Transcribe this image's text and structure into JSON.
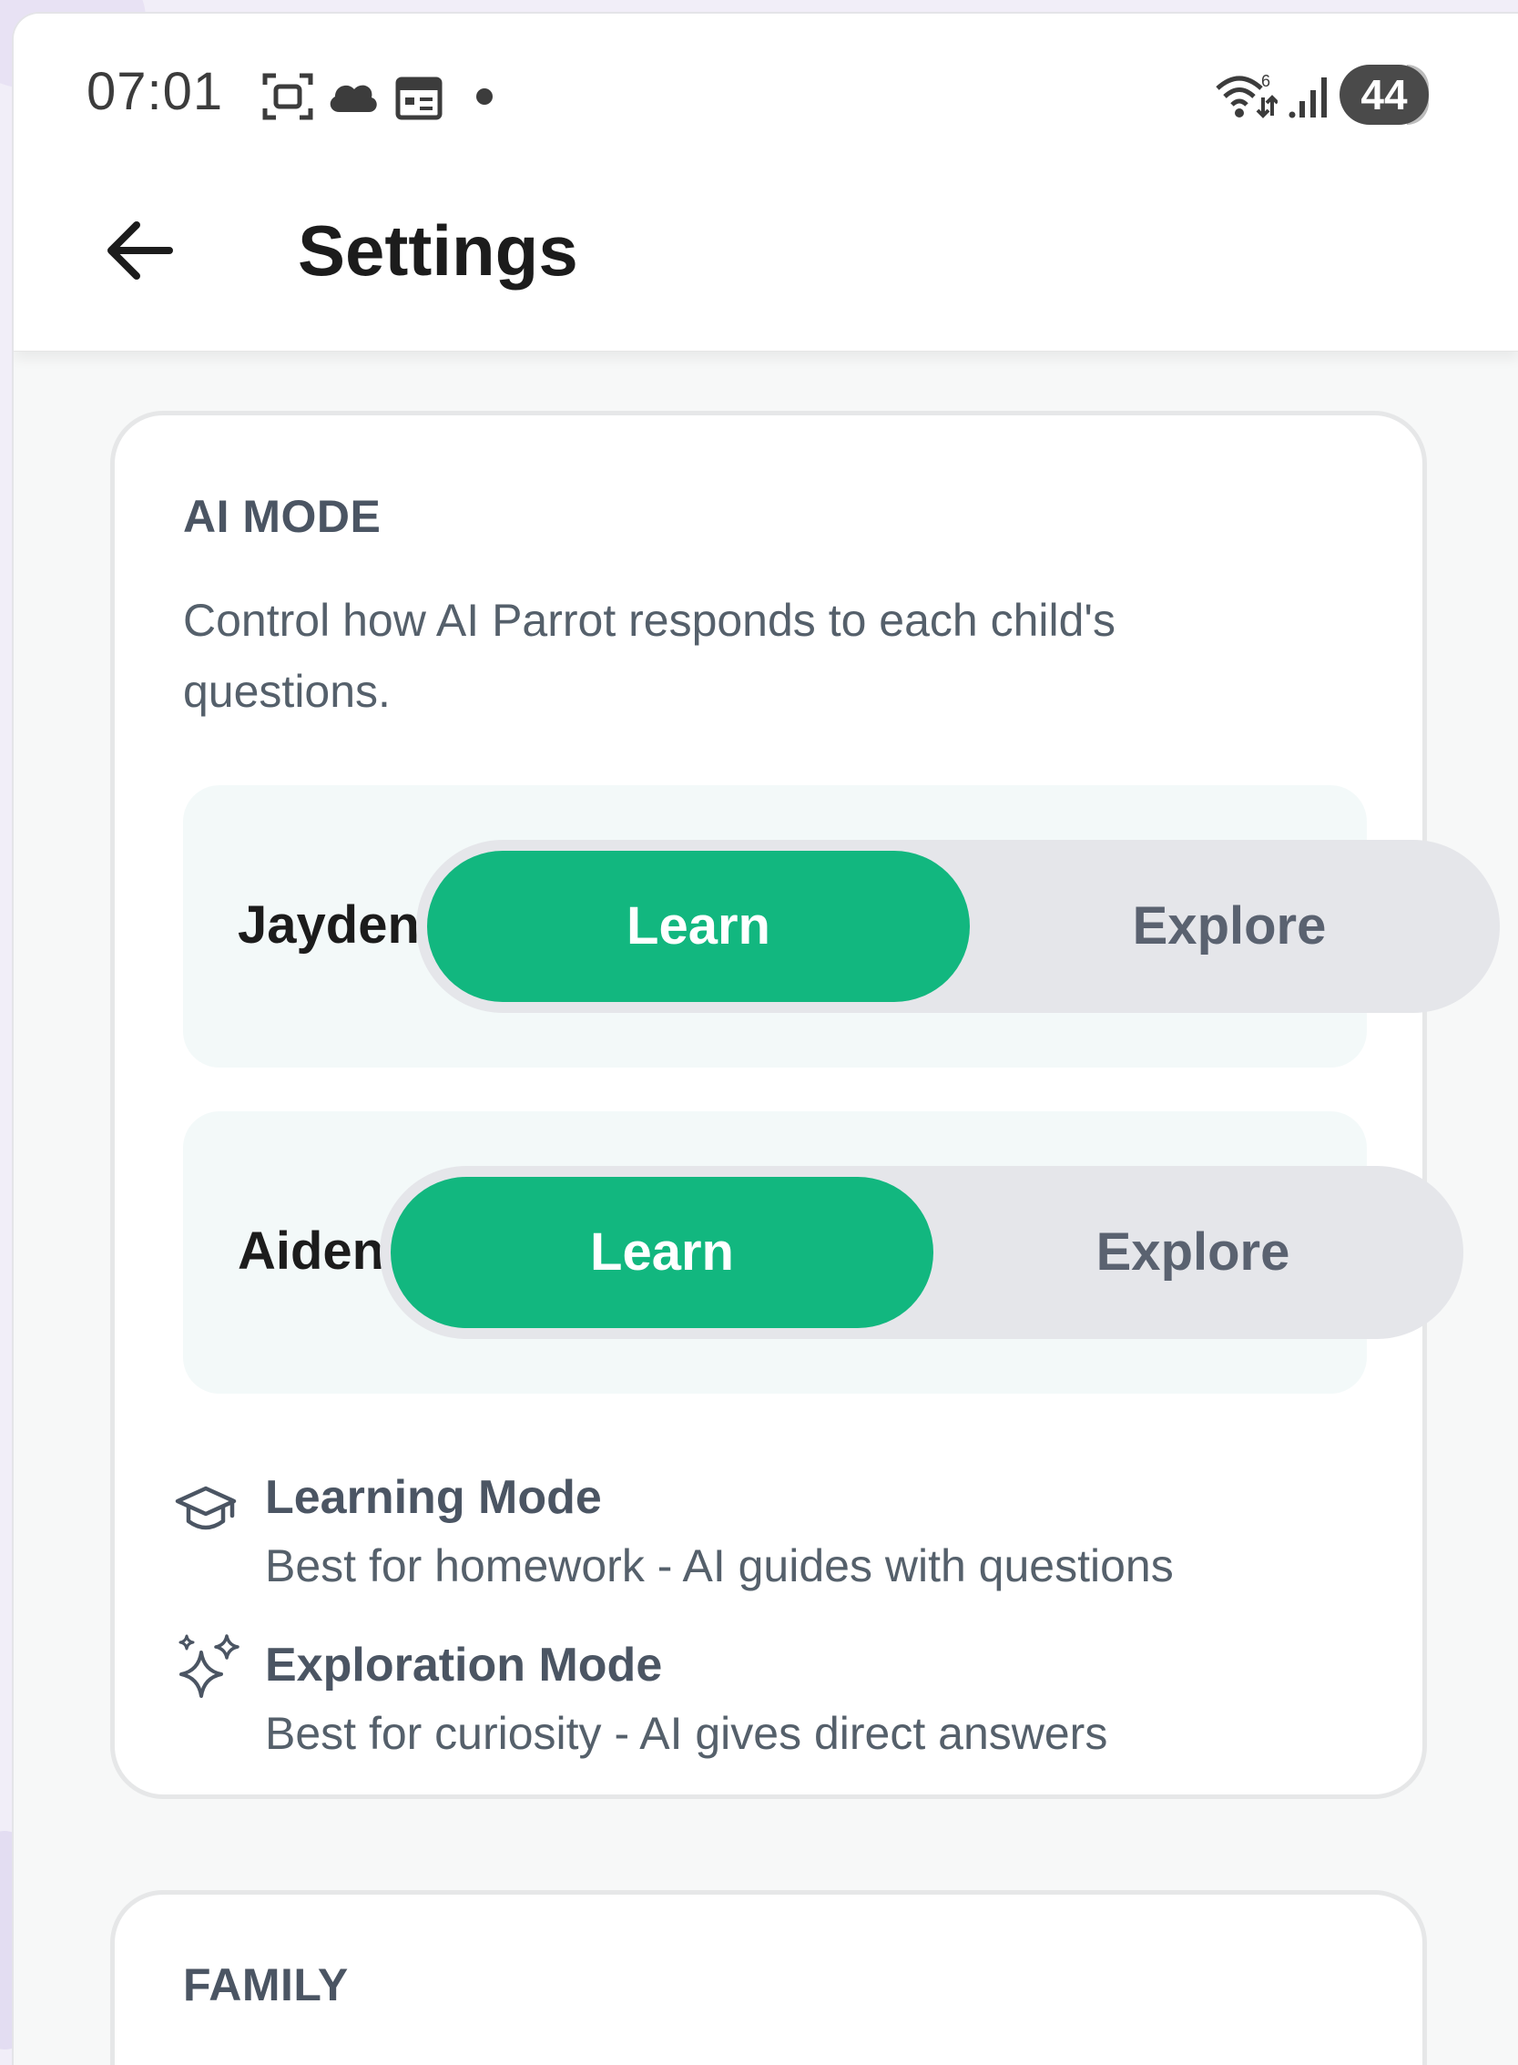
{
  "status_bar": {
    "time": "07:01",
    "battery_level": "44",
    "icons": [
      "screenshot-icon",
      "cloud-icon",
      "calendar-icon",
      "notification-dot-icon",
      "wifi-6-icon",
      "signal-icon",
      "battery-icon"
    ]
  },
  "header": {
    "title": "Settings",
    "back_icon": "arrow-left-icon"
  },
  "ai_mode": {
    "heading": "AI MODE",
    "description": "Control how AI Parrot responds to each child's questions.",
    "children": [
      {
        "name": "Jayden",
        "learn_label": "Learn",
        "explore_label": "Explore",
        "selected": "Learn"
      },
      {
        "name": "Aiden",
        "learn_label": "Learn",
        "explore_label": "Explore",
        "selected": "Learn"
      }
    ],
    "modes": [
      {
        "icon": "graduation-cap-icon",
        "title": "Learning Mode",
        "description": "Best for homework - AI guides with questions"
      },
      {
        "icon": "sparkles-icon",
        "title": "Exploration Mode",
        "description": "Best for curiosity - AI gives direct answers"
      }
    ]
  },
  "family": {
    "heading": "FAMILY"
  },
  "colors": {
    "accent": "#12b77f",
    "toggle_track": "#e5e6ea",
    "row_background": "#f3f9f9",
    "heading_text": "#4b5563"
  }
}
